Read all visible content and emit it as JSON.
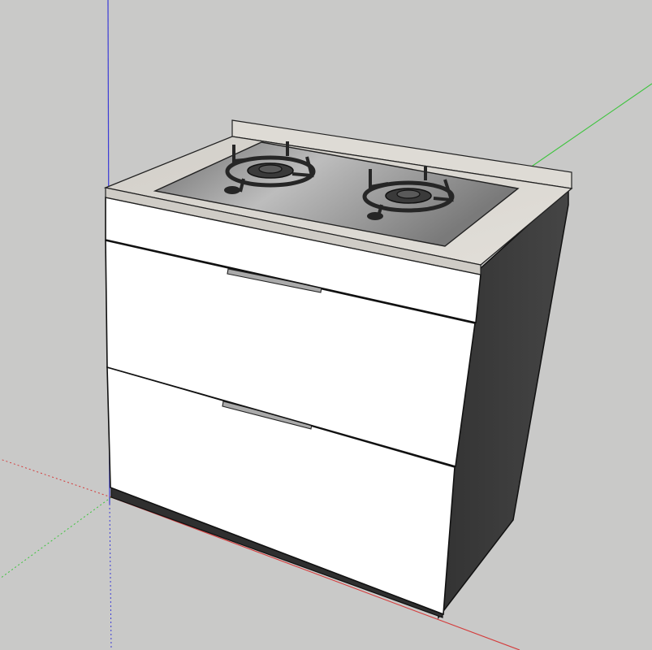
{
  "app": {
    "view": "3d-model-viewport",
    "scene_object": "base-cabinet-with-two-burner-gas-hob"
  },
  "colors": {
    "background": "#c9c9c8",
    "axis_blue": "#3b3bd6",
    "axis_green": "#3cc43c",
    "axis_red": "#d43c3c",
    "cabinet_front": "#ffffff",
    "cabinet_side": "#3d3d3d",
    "plinth": "#2f2f2f",
    "countertop": "#d9d6d0",
    "backsplash": "#dedbd5",
    "hob_glass": "#9a9a9a",
    "burner_iron": "#262626",
    "outline": "#111111"
  },
  "model": {
    "burner_count": 2,
    "drawer_count": 2,
    "components": [
      "countertop",
      "backsplash",
      "gas-hob",
      "left-burner",
      "right-burner",
      "top-fascia-panel",
      "upper-drawer",
      "lower-drawer",
      "side-panel",
      "plinth"
    ]
  }
}
